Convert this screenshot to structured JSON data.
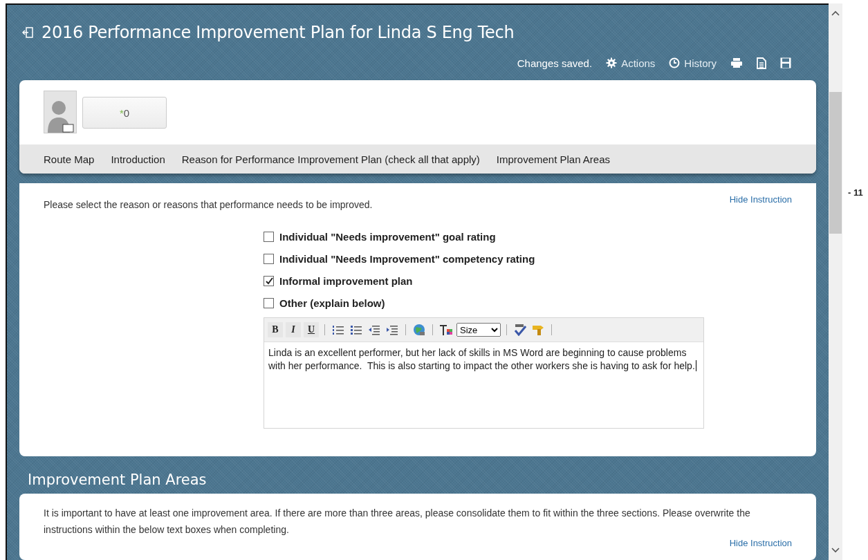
{
  "header": {
    "title": "2016 Performance Improvement Plan for Linda S Eng Tech",
    "status": "Changes saved.",
    "actions": [
      {
        "kind": "actions",
        "label": "Actions"
      },
      {
        "kind": "history",
        "label": "History"
      },
      {
        "kind": "print"
      },
      {
        "kind": "document"
      },
      {
        "kind": "save"
      }
    ]
  },
  "profile": {
    "rating_button": {
      "mark": "*",
      "count": "0"
    }
  },
  "nav": [
    "Route Map",
    "Introduction",
    "Reason for Performance Improvement Plan (check all that apply)",
    "Improvement Plan Areas"
  ],
  "reason_section": {
    "instruction": "Please select the reason or reasons that performance needs to be improved.",
    "hide_link": "Hide Instruction",
    "options": [
      {
        "label": "Individual \"Needs improvement\" goal rating",
        "checked": false
      },
      {
        "label": "Individual \"Needs Improvement\" competency rating",
        "checked": false
      },
      {
        "label": "Informal improvement plan",
        "checked": true
      },
      {
        "label": "Other (explain below)",
        "checked": false
      }
    ],
    "editor": {
      "toolbar": [
        {
          "kind": "bold",
          "label": "B"
        },
        {
          "kind": "italic",
          "label": "I"
        },
        {
          "kind": "underline",
          "label": "U"
        },
        {
          "kind": "sep"
        },
        {
          "kind": "ol"
        },
        {
          "kind": "ul"
        },
        {
          "kind": "outdent"
        },
        {
          "kind": "indent"
        },
        {
          "kind": "sep"
        },
        {
          "kind": "link"
        },
        {
          "kind": "sep"
        },
        {
          "kind": "color"
        },
        {
          "kind": "select",
          "label": "Size"
        },
        {
          "kind": "sep"
        },
        {
          "kind": "spell"
        },
        {
          "kind": "clean"
        },
        {
          "kind": "sep"
        }
      ],
      "text": "Linda is an excellent performer, but her lack of skills in MS Word are beginning to cause problems with her performance.  This is also starting to impact the other workers she is having to ask for help."
    }
  },
  "areas_section": {
    "title": "Improvement Plan Areas",
    "instruction": "It is important to have at least one improvement area. If there are more than three areas, please consolidate them to fit within the three sections. Please overwrite the instructions within the below text boxes when completing.",
    "hide_link": "Hide Instruction"
  },
  "page_marker": "- 11"
}
